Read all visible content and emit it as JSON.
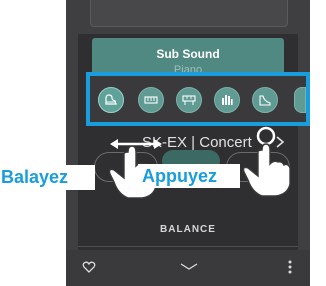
{
  "sub_sound": {
    "title": "Sub Sound",
    "value": "Piano"
  },
  "sound_icons": [
    {
      "icon": "grand-piano-icon",
      "selected": true
    },
    {
      "icon": "electric-piano-icon",
      "selected": false
    },
    {
      "icon": "electric-piano-2-icon",
      "selected": false
    },
    {
      "icon": "pipe-organ-icon",
      "selected": false
    },
    {
      "icon": "harpsichord-icon",
      "selected": false
    },
    {
      "icon": "more-sounds-icon",
      "selected": false
    }
  ],
  "current_sound": {
    "name": "SK-EX | Concert"
  },
  "balance": {
    "label": "BALANCE"
  },
  "gestures": {
    "swipe_label": "Balayez",
    "tap_label": "Appuyez"
  },
  "colors": {
    "highlight": "#1a9ddd",
    "teal": "#4f8982",
    "background": "#3f3f42"
  }
}
